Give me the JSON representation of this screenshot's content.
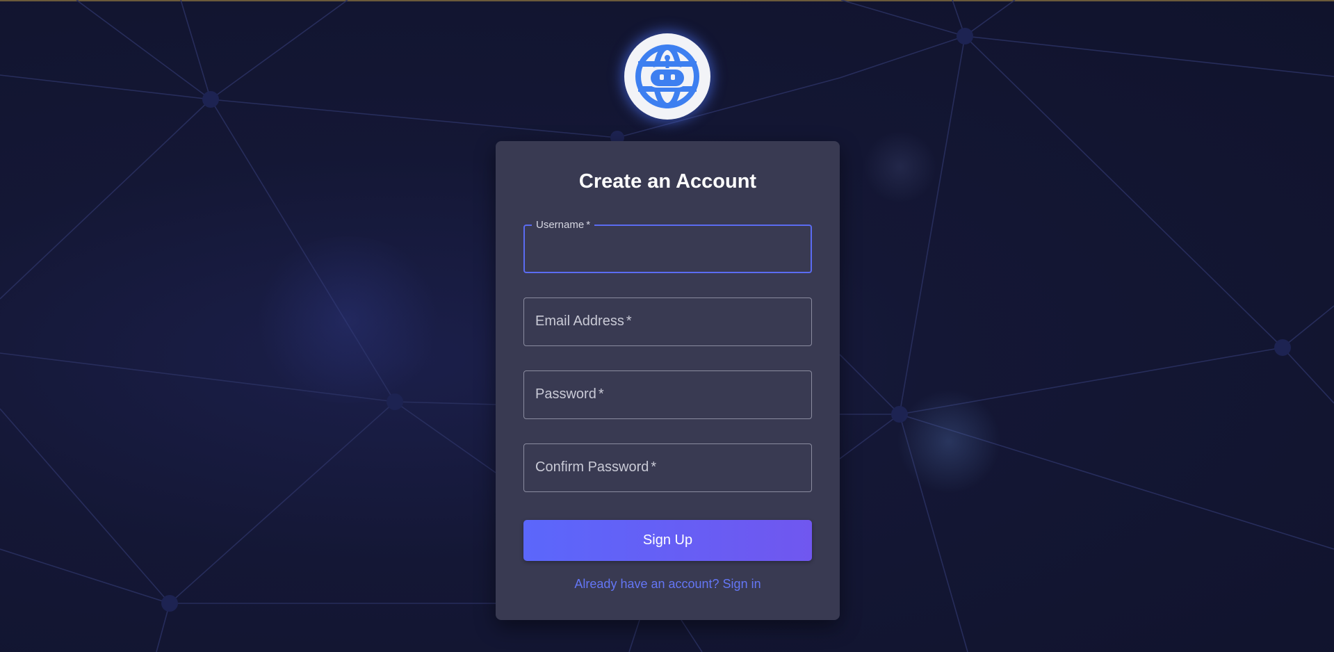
{
  "colors": {
    "background": "#141735",
    "card": "#393a52",
    "accent": "#5b6cf2",
    "button_gradient_start": "#5b67fb",
    "button_gradient_end": "#7057ef",
    "link": "#6476f5",
    "logo_icon": "#3d7ff0"
  },
  "logo": {
    "icon": "globe-robot-icon"
  },
  "form": {
    "title": "Create an Account",
    "fields": [
      {
        "label": "Username",
        "required_mark": "*",
        "value": "",
        "type": "text"
      },
      {
        "label": "Email Address",
        "required_mark": "*",
        "value": "",
        "type": "email"
      },
      {
        "label": "Password",
        "required_mark": "*",
        "value": "",
        "type": "password"
      },
      {
        "label": "Confirm Password",
        "required_mark": "*",
        "value": "",
        "type": "password"
      }
    ],
    "submit_label": "Sign Up",
    "signin_link": "Already have an account? Sign in"
  }
}
